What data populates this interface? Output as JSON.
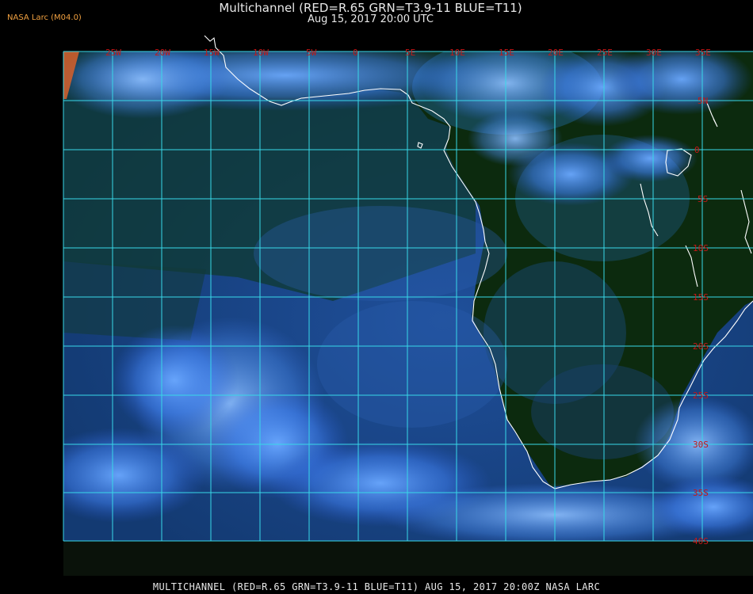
{
  "header": {
    "source": "NASA Larc (M04.0)",
    "title": "Multichannel (RED=R.65 GRN=T3.9-11 BLUE=T11)",
    "date": "Aug 15, 2017 20:00 UTC"
  },
  "map": {
    "longitude_labels": [
      "25W",
      "20W",
      "15W",
      "10W",
      "5W",
      "0",
      "5E",
      "10E",
      "15E",
      "20E",
      "25E",
      "30E",
      "35E"
    ],
    "latitude_labels": [
      "5N",
      "0",
      "5S",
      "10S",
      "15S",
      "20S",
      "25S",
      "30S",
      "35S",
      "40S"
    ],
    "colors": {
      "grid": "#38d8e8",
      "grid_label": "#c41818",
      "coastline": "#ffffff",
      "ocean_clear": "#16407a",
      "land": "#0d2a0a",
      "cloud": "#4a8cf0"
    }
  },
  "footer": {
    "caption": "MULTICHANNEL (RED=R.65 GRN=T3.9-11 BLUE=T11) AUG 15, 2017 20:00Z  NASA LARC"
  }
}
